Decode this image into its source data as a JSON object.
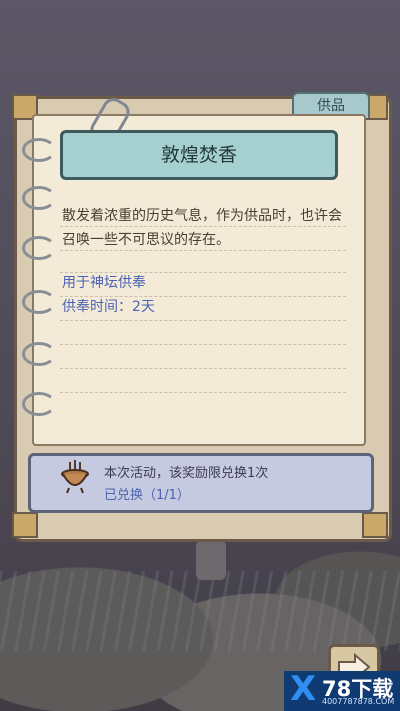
{
  "tab": {
    "label": "供品"
  },
  "item": {
    "title": "敦煌焚香",
    "description": "散发着浓重的历史气息，作为供品时，也许会召唤一些不可思议的存在。",
    "use": "用于神坛供奉",
    "duration": "供奉时间：2天"
  },
  "reward": {
    "limit_text": "本次活动，该奖励限兑换1次",
    "status": "已兑换（1/1）"
  },
  "watermark": {
    "brand": "78下载",
    "url": "4007787878.COM"
  },
  "colors": {
    "accent_blue": "#4d63b3",
    "title_bg": "#a6cfd0"
  }
}
